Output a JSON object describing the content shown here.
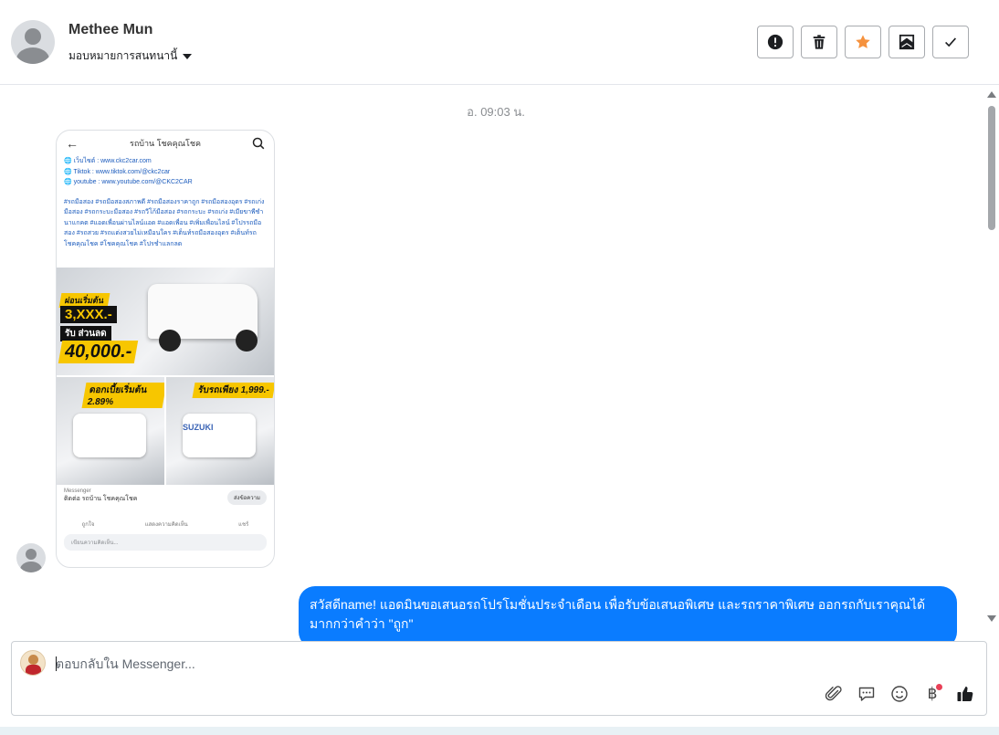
{
  "header": {
    "contact_name": "Methee Mun",
    "assign_label": "มอบหมายการสนทนานี้",
    "toolbar": {
      "spam_icon": "exclamation-circle-icon",
      "delete_icon": "trash-icon",
      "star_icon": "star-icon",
      "unread_icon": "mark-unread-icon",
      "done_icon": "check-icon"
    }
  },
  "chat": {
    "timestamp": "อ. 09:03 น.",
    "shared_post": {
      "page_name": "รถบ้าน โชคคุณโชค",
      "line_site": "🌐 เว็บไซต์ : www.ckc2car.com",
      "line_tiktok": "🌐 Tiktok : www.tiktok.com/@ckc2car",
      "line_youtube": "🌐 youtube : www.youtube.com/@CKC2CAR",
      "hashtags": "#รถมือสอง #รถมือสองสภาพดี #รถมือสองราคาถูก #รถมือสองอุดร #รถเก่งมือสอง #รถกระบะมือสอง #รถวีโก้มือสอง #รถกระบะ #รถเก่ง #เมียขาพีชำนาแกคต #แอดเพื่อนผ่านไลน์แอด #แอดเพื่อน #เพิ่มเพื่อนไลน์ #โปรรถมือสอง #รถสวย #รถแต่งสวยไม่เหมือนใคร #เต็นท์รถมือสองอุดร #เต็นท์รถโชคคุณโชค #โชคคุณโชค #โปรช่ำแลกลด",
      "promo_start": "ผ่อนเริ่มต้น",
      "promo_amount": "3,XXX.-",
      "promo_discount_label": "รับ ส่วนลด",
      "promo_discount": "40,000.-",
      "promo_interest": "ดอกเบี้ยเริ่มต้น 2.89%",
      "promo_down": "รับรถเพียง 1,999.-",
      "brand_badge": "SUZUKI",
      "footer_small": "Messenger",
      "footer_contact": "ติดต่อ รถบ้าน โชคคุณโชค",
      "send_message": "ส่งข้อความ",
      "action_like": "ถูกใจ",
      "action_comment": "แสดงความคิดเห็น",
      "action_share": "แชร์",
      "comment_placeholder": "เขียนความคิดเห็น..."
    },
    "outgoing_message": "สวัสดีname! แอดมินขอเสนอรถโปรโมชั่นประจำเดือน เพื่อรับข้อเสนอพิเศษ และรถราคาพิเศษ ออกรถกับเราคุณได้มากกว่าคำว่า \"ถูก\""
  },
  "composer": {
    "placeholder": "ตอบกลับใน Messenger...",
    "tools": [
      "paperclip-icon",
      "saved-replies-icon",
      "emoji-icon",
      "baht-payment-icon",
      "thumbs-up-icon"
    ]
  },
  "colors": {
    "bubble_out": "#0a7cff",
    "star": "#f5923e",
    "notification_dot": "#e94057"
  }
}
